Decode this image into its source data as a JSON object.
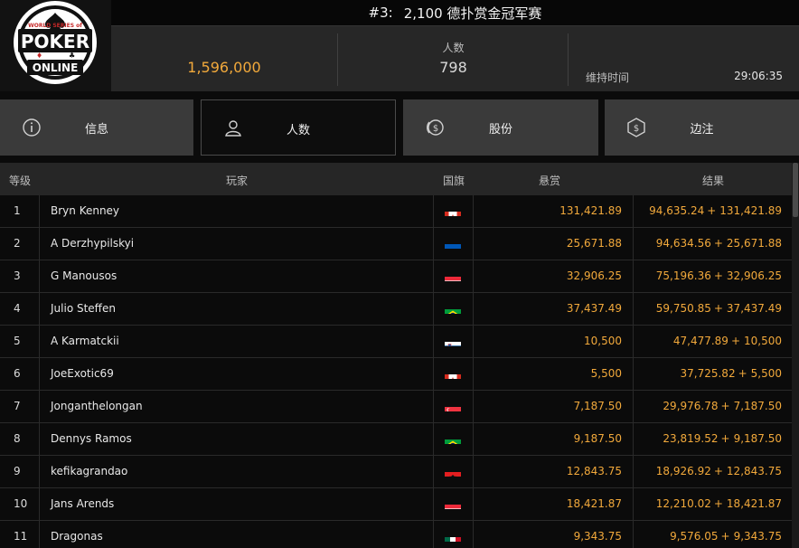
{
  "header": {
    "tournament_number": "#3:",
    "tournament_name": "2,100 德扑赏金冠军赛",
    "prize_pool": "1,596,000",
    "players_label": "人数",
    "players_value": "798",
    "duration_label": "维持时间",
    "duration_value": "29:06:35"
  },
  "logo": {
    "top_text": "WORLD SERIES of",
    "main_text": "POKER",
    "bottom_text": "ONLINE"
  },
  "tabs": [
    {
      "label": "信息",
      "icon": "info-icon"
    },
    {
      "label": "人数",
      "icon": "person-icon",
      "active": true
    },
    {
      "label": "股份",
      "icon": "coins-icon"
    },
    {
      "label": "边注",
      "icon": "side-bet-icon"
    }
  ],
  "table": {
    "columns": {
      "rank": "等级",
      "player": "玩家",
      "flag": "国旗",
      "bounty": "悬赏",
      "result": "结果"
    },
    "rows": [
      {
        "rank": "1",
        "player": "Bryn Kenney",
        "flag": "canada",
        "bounty": "131,421.89",
        "result_main": "94,635.24",
        "result_bounty": "131,421.89"
      },
      {
        "rank": "2",
        "player": "A Derzhypilskyi",
        "flag": "ukraine",
        "bounty": "25,671.88",
        "result_main": "94,634.56",
        "result_bounty": "25,671.88"
      },
      {
        "rank": "3",
        "player": "G Manousos",
        "flag": "austria",
        "bounty": "32,906.25",
        "result_main": "75,196.36",
        "result_bounty": "32,906.25"
      },
      {
        "rank": "4",
        "player": "Julio Steffen",
        "flag": "brazil",
        "bounty": "37,437.49",
        "result_main": "59,750.85",
        "result_bounty": "37,437.49"
      },
      {
        "rank": "5",
        "player": "A Karmatckii",
        "flag": "slovenia",
        "bounty": "10,500",
        "result_main": "47,477.89",
        "result_bounty": "10,500"
      },
      {
        "rank": "6",
        "player": "JoeExotic69",
        "flag": "canada",
        "bounty": "5,500",
        "result_main": "37,725.82",
        "result_bounty": "5,500"
      },
      {
        "rank": "7",
        "player": "Jonganthelongan",
        "flag": "singapore",
        "bounty": "7,187.50",
        "result_main": "29,976.78",
        "result_bounty": "7,187.50"
      },
      {
        "rank": "8",
        "player": "Dennys Ramos",
        "flag": "brazil",
        "bounty": "9,187.50",
        "result_main": "23,819.52",
        "result_bounty": "9,187.50"
      },
      {
        "rank": "9",
        "player": "kefikagrandao",
        "flag": "albania",
        "bounty": "12,843.75",
        "result_main": "18,926.92",
        "result_bounty": "12,843.75"
      },
      {
        "rank": "10",
        "player": "Jans Arends",
        "flag": "austria",
        "bounty": "18,421.87",
        "result_main": "12,210.02",
        "result_bounty": "18,421.87"
      },
      {
        "rank": "11",
        "player": "Dragonas",
        "flag": "mexico",
        "bounty": "9,343.75",
        "result_main": "9,576.05",
        "result_bounty": "9,343.75"
      }
    ],
    "plus_sign": "+"
  },
  "colors": {
    "accent": "#f2a93b",
    "background": "#0b0b0b",
    "tab_bg": "#3a3a3a",
    "stats_bg": "#272727"
  }
}
